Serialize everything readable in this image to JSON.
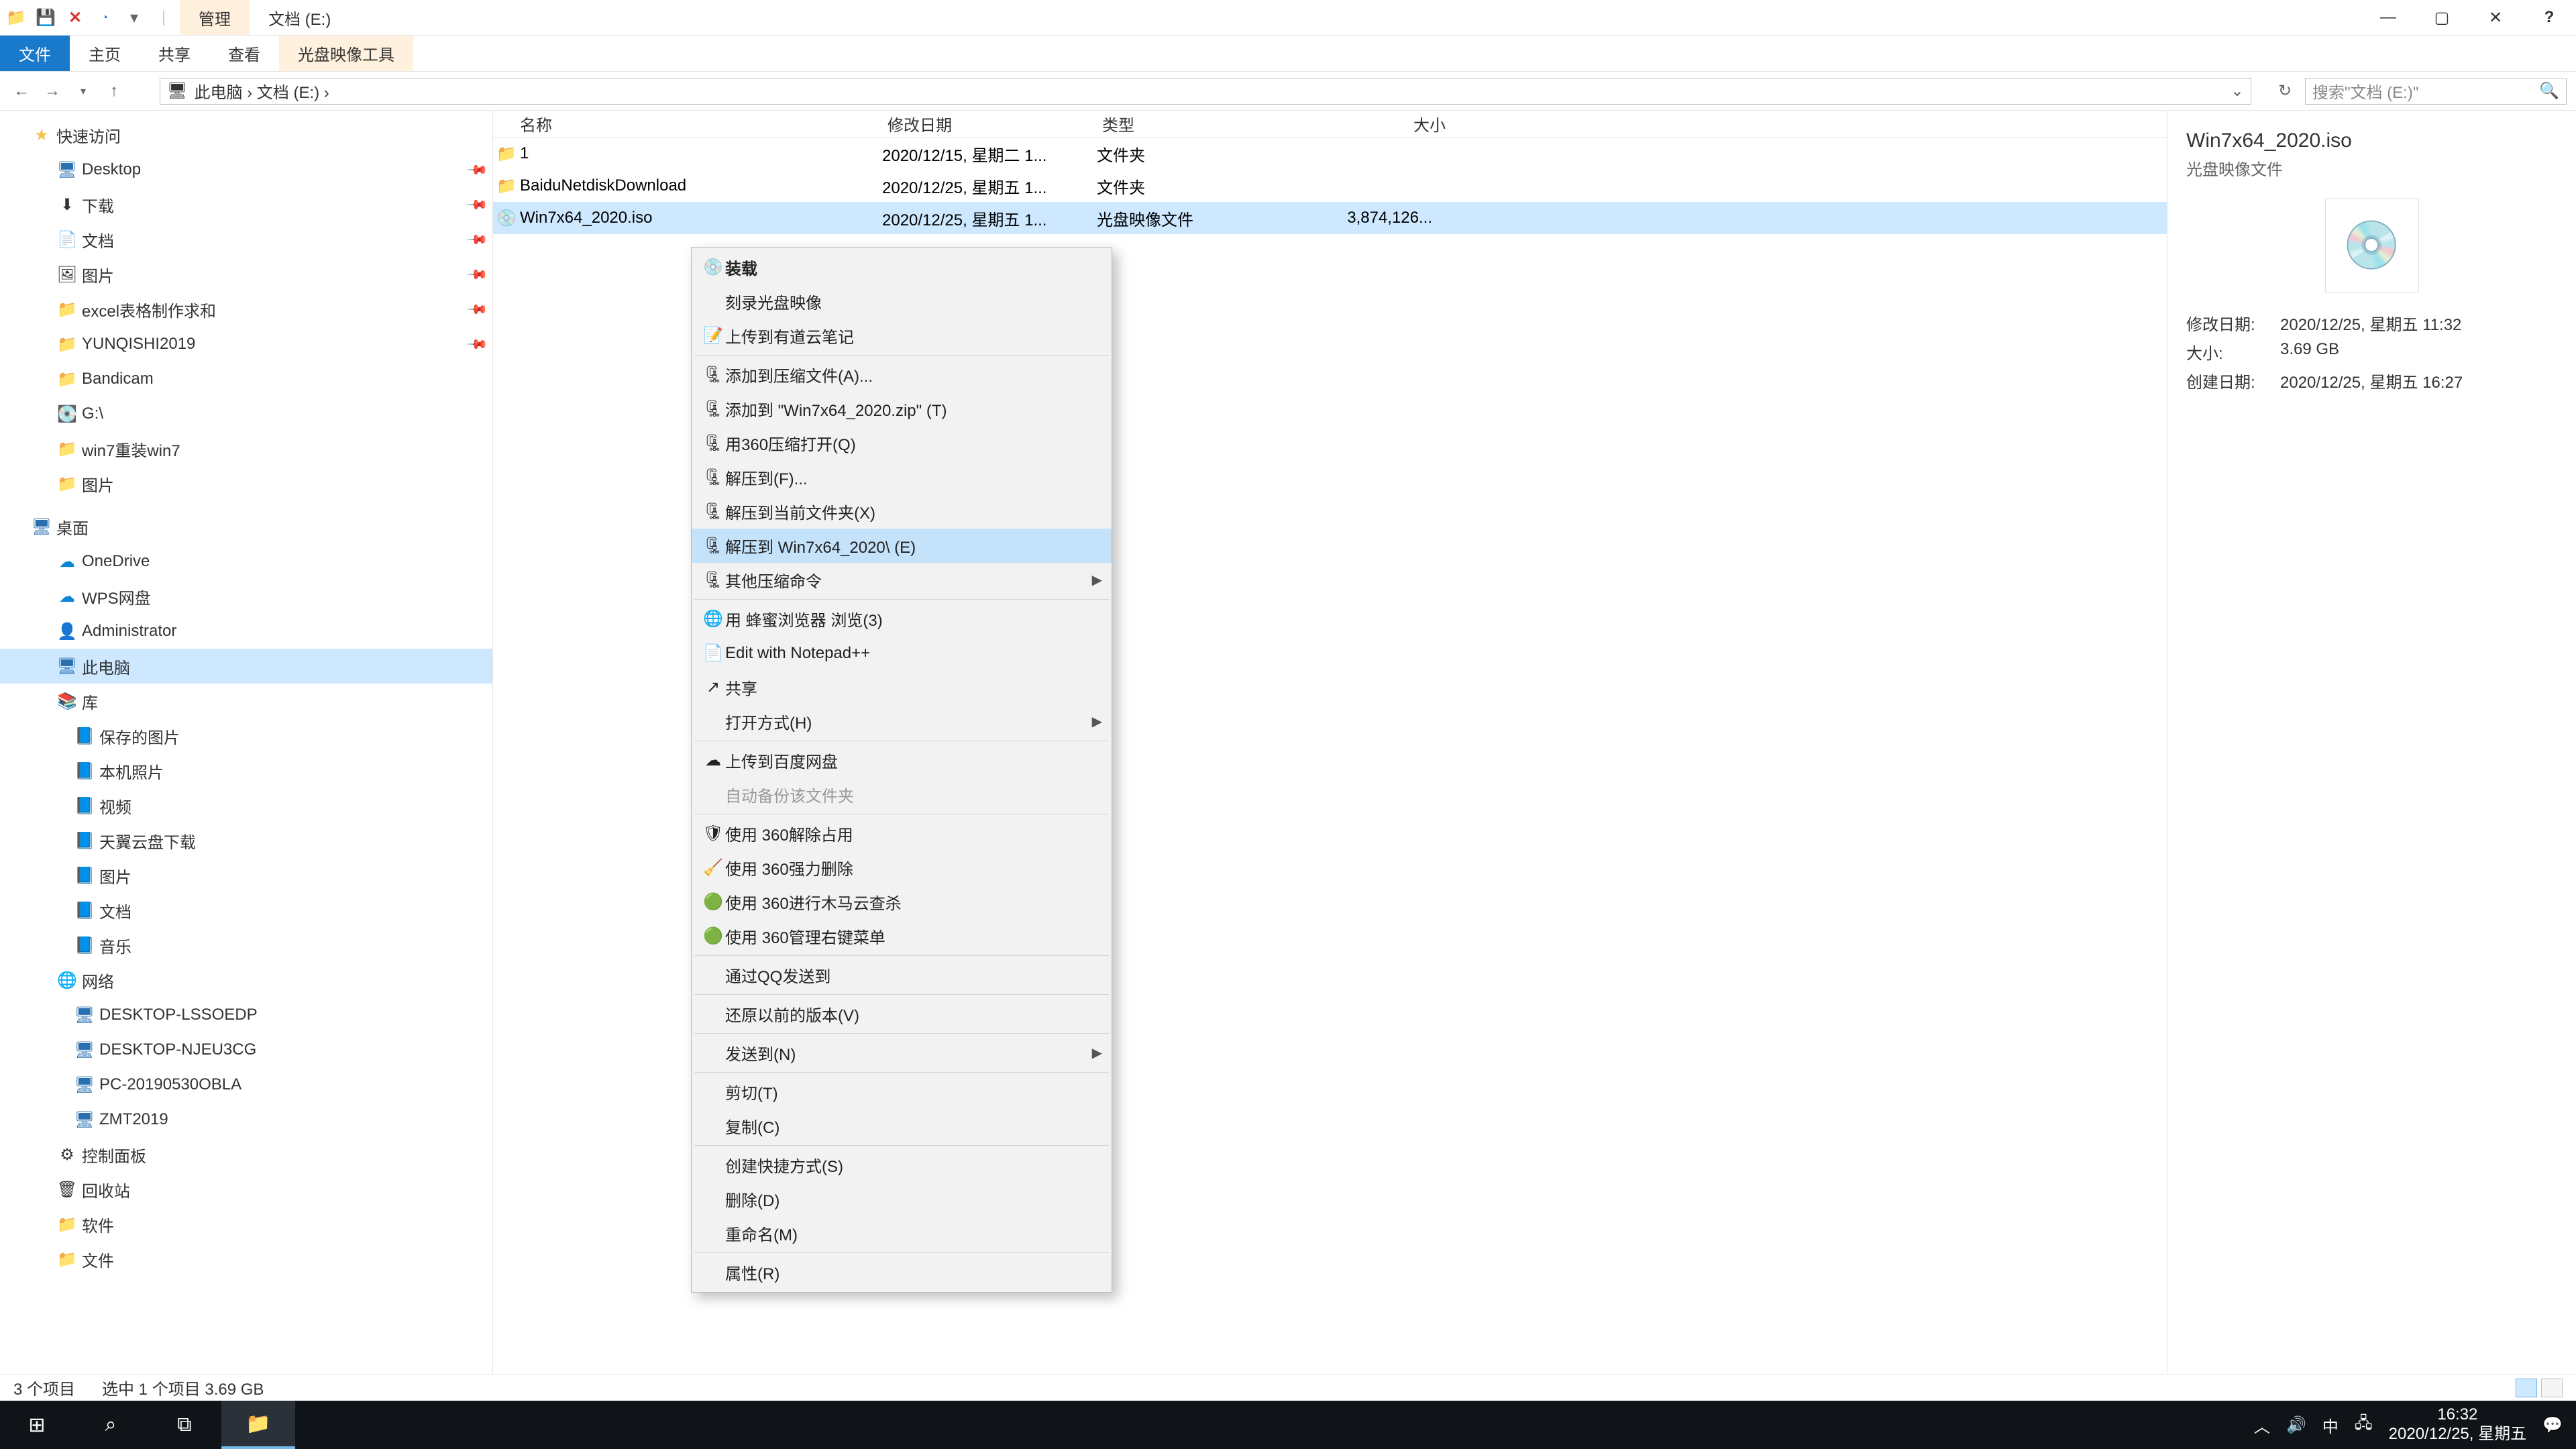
{
  "titlebar": {
    "manage_tab": "管理",
    "window_title": "文档 (E:)"
  },
  "ribbon": {
    "file": "文件",
    "home": "主页",
    "share": "共享",
    "view": "查看",
    "disc_tools": "光盘映像工具"
  },
  "nav": {
    "breadcrumb": "此电脑  ›  文档 (E:)  ›",
    "search_placeholder": "搜索\"文档 (E:)\""
  },
  "columns": {
    "name": "名称",
    "modified": "修改日期",
    "type": "类型",
    "size": "大小"
  },
  "sidebar": {
    "quick_access": "快速访问",
    "desktop": "Desktop",
    "downloads": "下载",
    "documents": "文档",
    "pictures": "图片",
    "excel": "excel表格制作求和",
    "yunqishi": "YUNQISHI2019",
    "bandicam": "Bandicam",
    "gdrive": "G:\\",
    "win7reinstall": "win7重装win7",
    "pictures2": "图片",
    "desktop_root": "桌面",
    "onedrive": "OneDrive",
    "wps": "WPS网盘",
    "administrator": "Administrator",
    "thispc": "此电脑",
    "libraries": "库",
    "saved_pictures": "保存的图片",
    "camera_roll": "本机照片",
    "videos": "视频",
    "tianyi": "天翼云盘下载",
    "pictures3": "图片",
    "documents2": "文档",
    "music": "音乐",
    "network": "网络",
    "pc1": "DESKTOP-LSSOEDP",
    "pc2": "DESKTOP-NJEU3CG",
    "pc3": "PC-20190530OBLA",
    "pc4": "ZMT2019",
    "control_panel": "控制面板",
    "recycle": "回收站",
    "software": "软件",
    "files": "文件"
  },
  "files": [
    {
      "name": "1",
      "modified": "2020/12/15, 星期二 1...",
      "type": "文件夹",
      "size": ""
    },
    {
      "name": "BaiduNetdiskDownload",
      "modified": "2020/12/25, 星期五 1...",
      "type": "文件夹",
      "size": ""
    },
    {
      "name": "Win7x64_2020.iso",
      "modified": "2020/12/25, 星期五 1...",
      "type": "光盘映像文件",
      "size": "3,874,126..."
    }
  ],
  "details": {
    "title": "Win7x64_2020.iso",
    "subtitle": "光盘映像文件",
    "modified_label": "修改日期:",
    "modified_value": "2020/12/25, 星期五 11:32",
    "size_label": "大小:",
    "size_value": "3.69 GB",
    "created_label": "创建日期:",
    "created_value": "2020/12/25, 星期五 16:27"
  },
  "status": {
    "count": "3 个项目",
    "selected": "选中 1 个项目  3.69 GB"
  },
  "context_menu": [
    {
      "icon": "disc",
      "label": "装载",
      "bold": true
    },
    {
      "icon": "",
      "label": "刻录光盘映像"
    },
    {
      "icon": "note",
      "label": "上传到有道云笔记"
    },
    {
      "sep": true
    },
    {
      "icon": "archive",
      "label": "添加到压缩文件(A)..."
    },
    {
      "icon": "archive",
      "label": "添加到 \"Win7x64_2020.zip\" (T)"
    },
    {
      "icon": "archive",
      "label": "用360压缩打开(Q)"
    },
    {
      "icon": "archive",
      "label": "解压到(F)..."
    },
    {
      "icon": "archive",
      "label": "解压到当前文件夹(X)"
    },
    {
      "icon": "archive",
      "label": "解压到 Win7x64_2020\\ (E)",
      "highlight": true
    },
    {
      "icon": "archive",
      "label": "其他压缩命令",
      "submenu": true
    },
    {
      "sep": true
    },
    {
      "icon": "browser",
      "label": "用 蜂蜜浏览器 浏览(3)"
    },
    {
      "icon": "npp",
      "label": "Edit with Notepad++"
    },
    {
      "icon": "share",
      "label": "共享"
    },
    {
      "icon": "",
      "label": "打开方式(H)",
      "submenu": true
    },
    {
      "sep": true
    },
    {
      "icon": "baidu",
      "label": "上传到百度网盘"
    },
    {
      "icon": "",
      "label": "自动备份该文件夹",
      "disabled": true
    },
    {
      "sep": true
    },
    {
      "icon": "360a",
      "label": "使用 360解除占用"
    },
    {
      "icon": "360b",
      "label": "使用 360强力删除"
    },
    {
      "icon": "360c",
      "label": "使用 360进行木马云查杀"
    },
    {
      "icon": "360c",
      "label": "使用 360管理右键菜单"
    },
    {
      "sep": true
    },
    {
      "icon": "",
      "label": "通过QQ发送到"
    },
    {
      "sep": true
    },
    {
      "icon": "",
      "label": "还原以前的版本(V)"
    },
    {
      "sep": true
    },
    {
      "icon": "",
      "label": "发送到(N)",
      "submenu": true
    },
    {
      "sep": true
    },
    {
      "icon": "",
      "label": "剪切(T)"
    },
    {
      "icon": "",
      "label": "复制(C)"
    },
    {
      "sep": true
    },
    {
      "icon": "",
      "label": "创建快捷方式(S)"
    },
    {
      "icon": "",
      "label": "删除(D)"
    },
    {
      "icon": "",
      "label": "重命名(M)"
    },
    {
      "sep": true
    },
    {
      "icon": "",
      "label": "属性(R)"
    }
  ],
  "taskbar": {
    "ime": "中",
    "time": "16:32",
    "date": "2020/12/25, 星期五"
  }
}
